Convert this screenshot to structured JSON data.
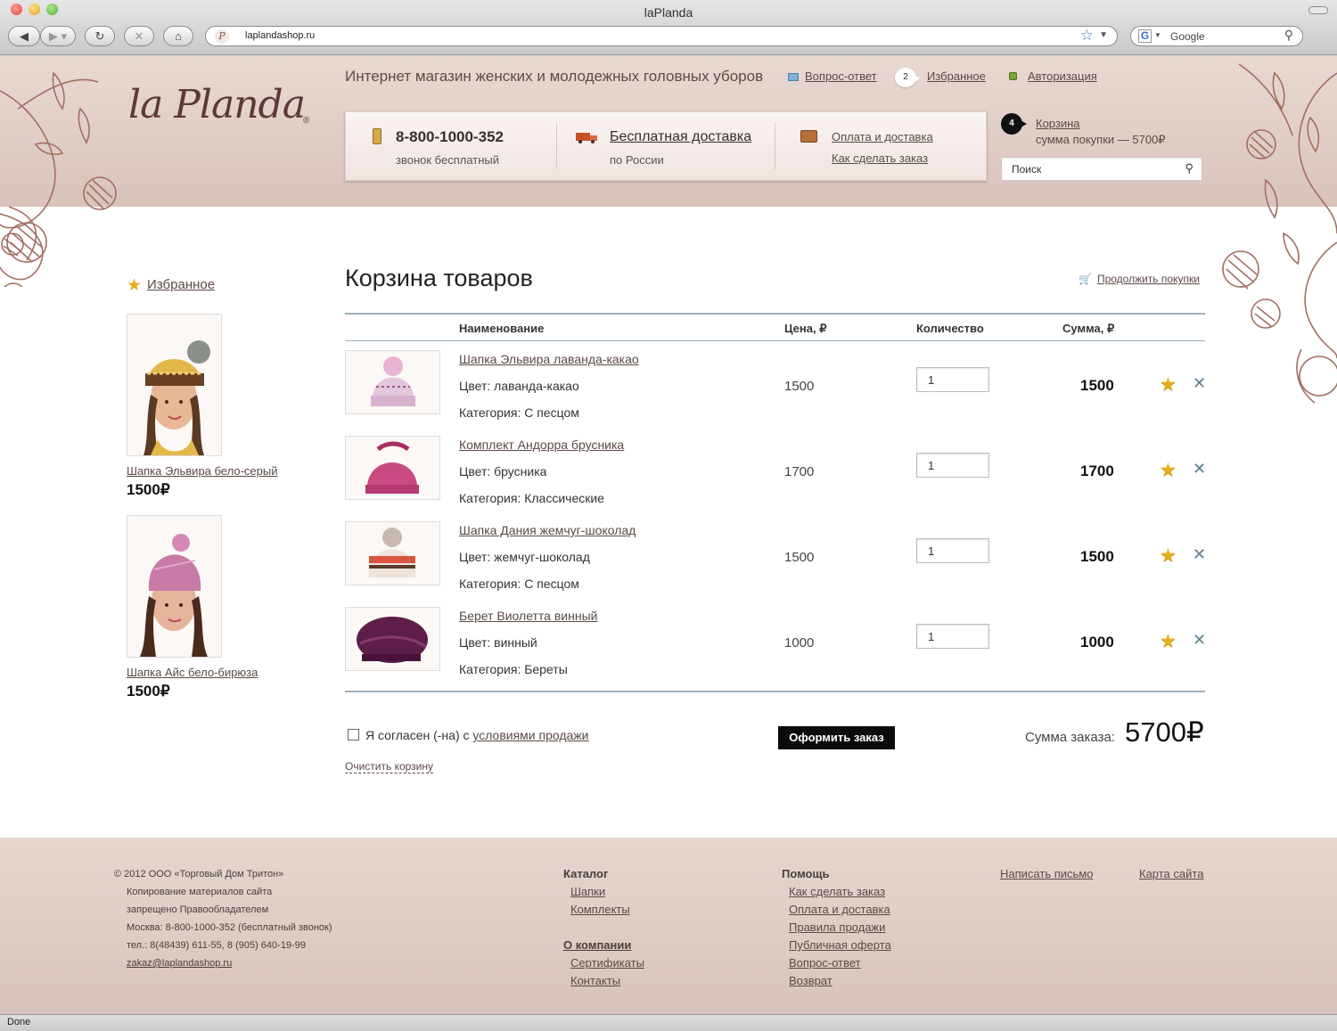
{
  "browser": {
    "window_title": "laPlanda",
    "url": "laplandashop.ru",
    "search_placeholder": "Google",
    "status": "Done"
  },
  "header": {
    "logo": "la Planda",
    "logo_mark": "®",
    "tagline": "Интернет магазин женских и молодежных головных уборов",
    "faq_label": "Вопрос-ответ",
    "favorites_count": "2",
    "favorites_label": "Избранное",
    "login_label": "Авторизация",
    "phone": "8-800-1000-352",
    "phone_note": "звонок бесплатный",
    "delivery_label": "Бесплатная доставка",
    "delivery_note": "по России",
    "payment_label": "Оплата и доставка",
    "how_to_order_label": "Как сделать заказ",
    "cart_count": "4",
    "cart_label": "Корзина",
    "cart_sum": "сумма покупки — 5700₽",
    "search_placeholder": "Поиск"
  },
  "sidebar": {
    "title": "Избранное",
    "items": [
      {
        "name": "Шапка Эльвира бело-серый",
        "price": "1500₽"
      },
      {
        "name": "Шапка Айс бело-бирюза",
        "price": "1500₽"
      }
    ]
  },
  "cart": {
    "title": "Корзина товаров",
    "continue_label": "Продолжить покупки",
    "columns": {
      "name": "Наименование",
      "price": "Цена, ₽",
      "qty": "Количество",
      "sum": "Сумма, ₽"
    },
    "items": [
      {
        "name": "Шапка Эльвира лаванда-какао",
        "color": "Цвет: лаванда-какао",
        "category": "Категория: С песцом",
        "price": "1500",
        "qty": "1",
        "sum": "1500"
      },
      {
        "name": "Комплект Андорра брусника",
        "color": "Цвет: брусника",
        "category": "Категория: Классические",
        "price": "1700",
        "qty": "1",
        "sum": "1700"
      },
      {
        "name": "Шапка Дания жемчуг-шоколад",
        "color": "Цвет: жемчуг-шоколад",
        "category": "Категория: С песцом",
        "price": "1500",
        "qty": "1",
        "sum": "1500"
      },
      {
        "name": "Берет Виолетта винный",
        "color": "Цвет: винный",
        "category": "Категория: Береты",
        "price": "1000",
        "qty": "1",
        "sum": "1000"
      }
    ],
    "agree_text": "Я согласен (-на) с ",
    "agree_link": "условиями продажи",
    "order_button": "Оформить заказ",
    "total_label": "Сумма заказа:",
    "total_value": "5700₽",
    "clear_label": "Очистить корзину"
  },
  "footer": {
    "legal": [
      "© 2012 ООО «Торговый Дом Тритон»",
      "Копирование материалов сайта",
      "запрещено Правообладателем",
      "Москва: 8-800-1000-352 (бесплатный звонок)",
      "тел.: 8(48439) 611-55, 8 (905) 640-19-99",
      "zakaz@laplandashop.ru"
    ],
    "catalog_title": "Каталог",
    "catalog_links": [
      "Шапки",
      "Комплекты"
    ],
    "company_title": "О компании",
    "company_links": [
      "Сертификаты",
      "Контакты"
    ],
    "help_title": "Помощь",
    "help_links": [
      "Как сделать заказ",
      "Оплата и доставка",
      "Правила продажи",
      "Публичная оферта",
      "Вопрос-ответ",
      "Возврат"
    ],
    "write_label": "Написать письмо",
    "sitemap_label": "Карта сайта"
  },
  "colors": {
    "header_bg": "#e2d0ca",
    "accent_brown": "#5c3a33",
    "divider": "#9aafbb",
    "star": "#e8b020"
  }
}
